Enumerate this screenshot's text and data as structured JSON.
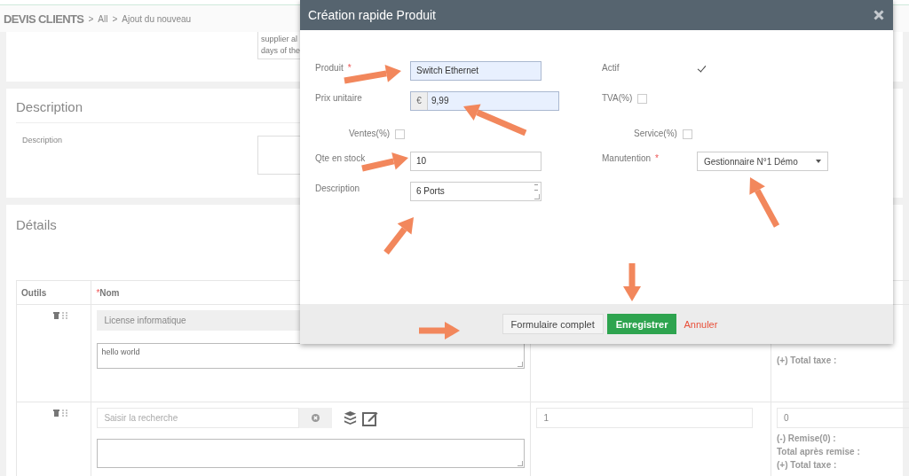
{
  "breadcrumb": {
    "module": "DEVIS CLIENTS",
    "separator": ">",
    "items": [
      "All",
      "Ajout du nouveau"
    ]
  },
  "top_card": {
    "text_lines": [
      "supplier al",
      "days of the"
    ]
  },
  "description_card": {
    "title": "Description",
    "label": "Description"
  },
  "details_card": {
    "title": "Détails",
    "columns": [
      {
        "label": "Outils"
      },
      {
        "label": "Nom",
        "required_mark": "*"
      }
    ],
    "rows": [
      {
        "kind": "product",
        "name": "License informatique",
        "note": "hello world",
        "totals": [
          "(+) Total taxe :"
        ]
      },
      {
        "kind": "search",
        "search_placeholder": "Saisir la recherche",
        "quantity": "1",
        "price": "0",
        "totals": [
          "(-) Remise(0) :",
          "Total après remise :",
          "(+) Total taxe :"
        ]
      }
    ]
  },
  "modal": {
    "title": "Création rapide Produit",
    "rows": [
      [
        {
          "kind": "text",
          "label": "Produit",
          "required_mark": "*",
          "value": "Switch Ethernet",
          "autofilled": true
        },
        {
          "kind": "checkbox",
          "label": "Actif",
          "checked": true
        }
      ],
      [
        {
          "kind": "currency",
          "label": "Prix unitaire",
          "prefix": "€",
          "value": "9,99",
          "autofilled": true
        },
        {
          "kind": "inline-checkbox",
          "label": "TVA(%)",
          "checked": false
        }
      ],
      [
        {
          "kind": "indented-checkbox",
          "label": "Ventes(%)",
          "checked": false
        },
        {
          "kind": "indented-checkbox",
          "label": "Service(%)",
          "checked": false
        }
      ],
      [
        {
          "kind": "text",
          "label": "Qte en stock",
          "value": "10",
          "autofilled": false
        },
        {
          "kind": "select",
          "label": "Manutention",
          "required_mark": "*",
          "value": "Gestionnaire N°1 Démo"
        }
      ],
      [
        {
          "kind": "textarea",
          "label": "Description",
          "value": "6 Ports"
        }
      ]
    ],
    "buttons": [
      {
        "kind": "default",
        "label": "Formulaire complet"
      },
      {
        "kind": "primary",
        "label": "Enregistrer"
      },
      {
        "kind": "link",
        "label": "Annuler"
      }
    ]
  }
}
